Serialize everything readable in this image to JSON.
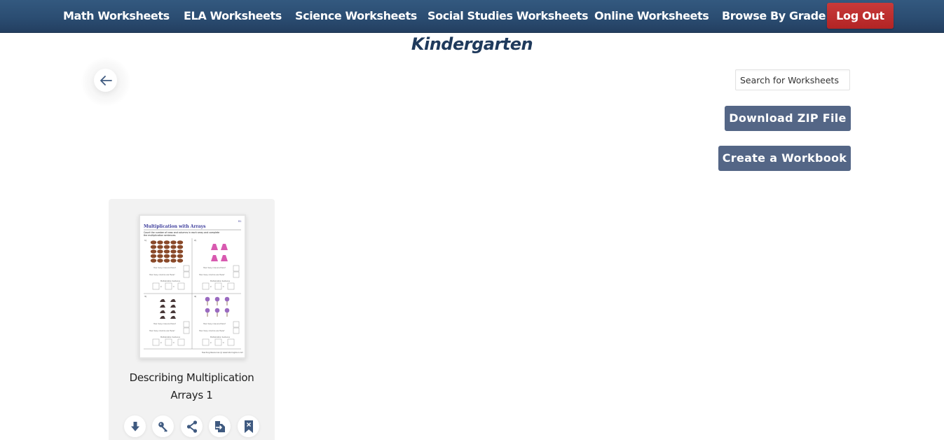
{
  "nav": {
    "items": [
      {
        "label": "Math Worksheets"
      },
      {
        "label": "ELA Worksheets"
      },
      {
        "label": "Science Worksheets"
      },
      {
        "label": "Social Studies Worksheets"
      },
      {
        "label": "Online Worksheets"
      },
      {
        "label": "Browse By Grade"
      }
    ],
    "logout_label": "Log Out"
  },
  "page": {
    "title": "Kindergarten",
    "back_icon": "arrow-left-icon"
  },
  "search": {
    "placeholder": "Search for Worksheets",
    "value": ""
  },
  "actions": {
    "download_zip_label": "Download ZIP File",
    "create_workbook_label": "Create a Workbook"
  },
  "worksheets": [
    {
      "title": "Describing Multiplication Arrays 1",
      "thumbnail": {
        "heading": "Multiplication with Arrays",
        "instructions": "Count the number of rows and columns in each array and complete the multiplication sentences.",
        "row_question": "How many rows are there?",
        "col_question": "How many columns are there?",
        "sentence_label": "Multiplication Sentence",
        "footer": "Teaching Resources @ www.tutoringhour.com",
        "problems": [
          {
            "n": "1)",
            "item": "cookie",
            "color": "#8a4a2a"
          },
          {
            "n": "2)",
            "item": "dress",
            "color": "#d85ab0"
          },
          {
            "n": "3)",
            "item": "iron",
            "color": "#4a3a3a"
          },
          {
            "n": "4)",
            "item": "lollipop",
            "color": "#9a6ac0"
          }
        ]
      },
      "actions": [
        {
          "name": "download",
          "icon": "download-arrow-icon"
        },
        {
          "name": "answer-key",
          "icon": "key-icon"
        },
        {
          "name": "share",
          "icon": "share-icon"
        },
        {
          "name": "assign",
          "icon": "file-export-icon"
        },
        {
          "name": "bookmark",
          "icon": "bookmark-remove-icon"
        }
      ]
    }
  ],
  "colors": {
    "nav_bg": "#2b4d72",
    "logout": "#b32424",
    "button": "#546686",
    "title": "#1f3a5c",
    "icon": "#3f5a80"
  }
}
